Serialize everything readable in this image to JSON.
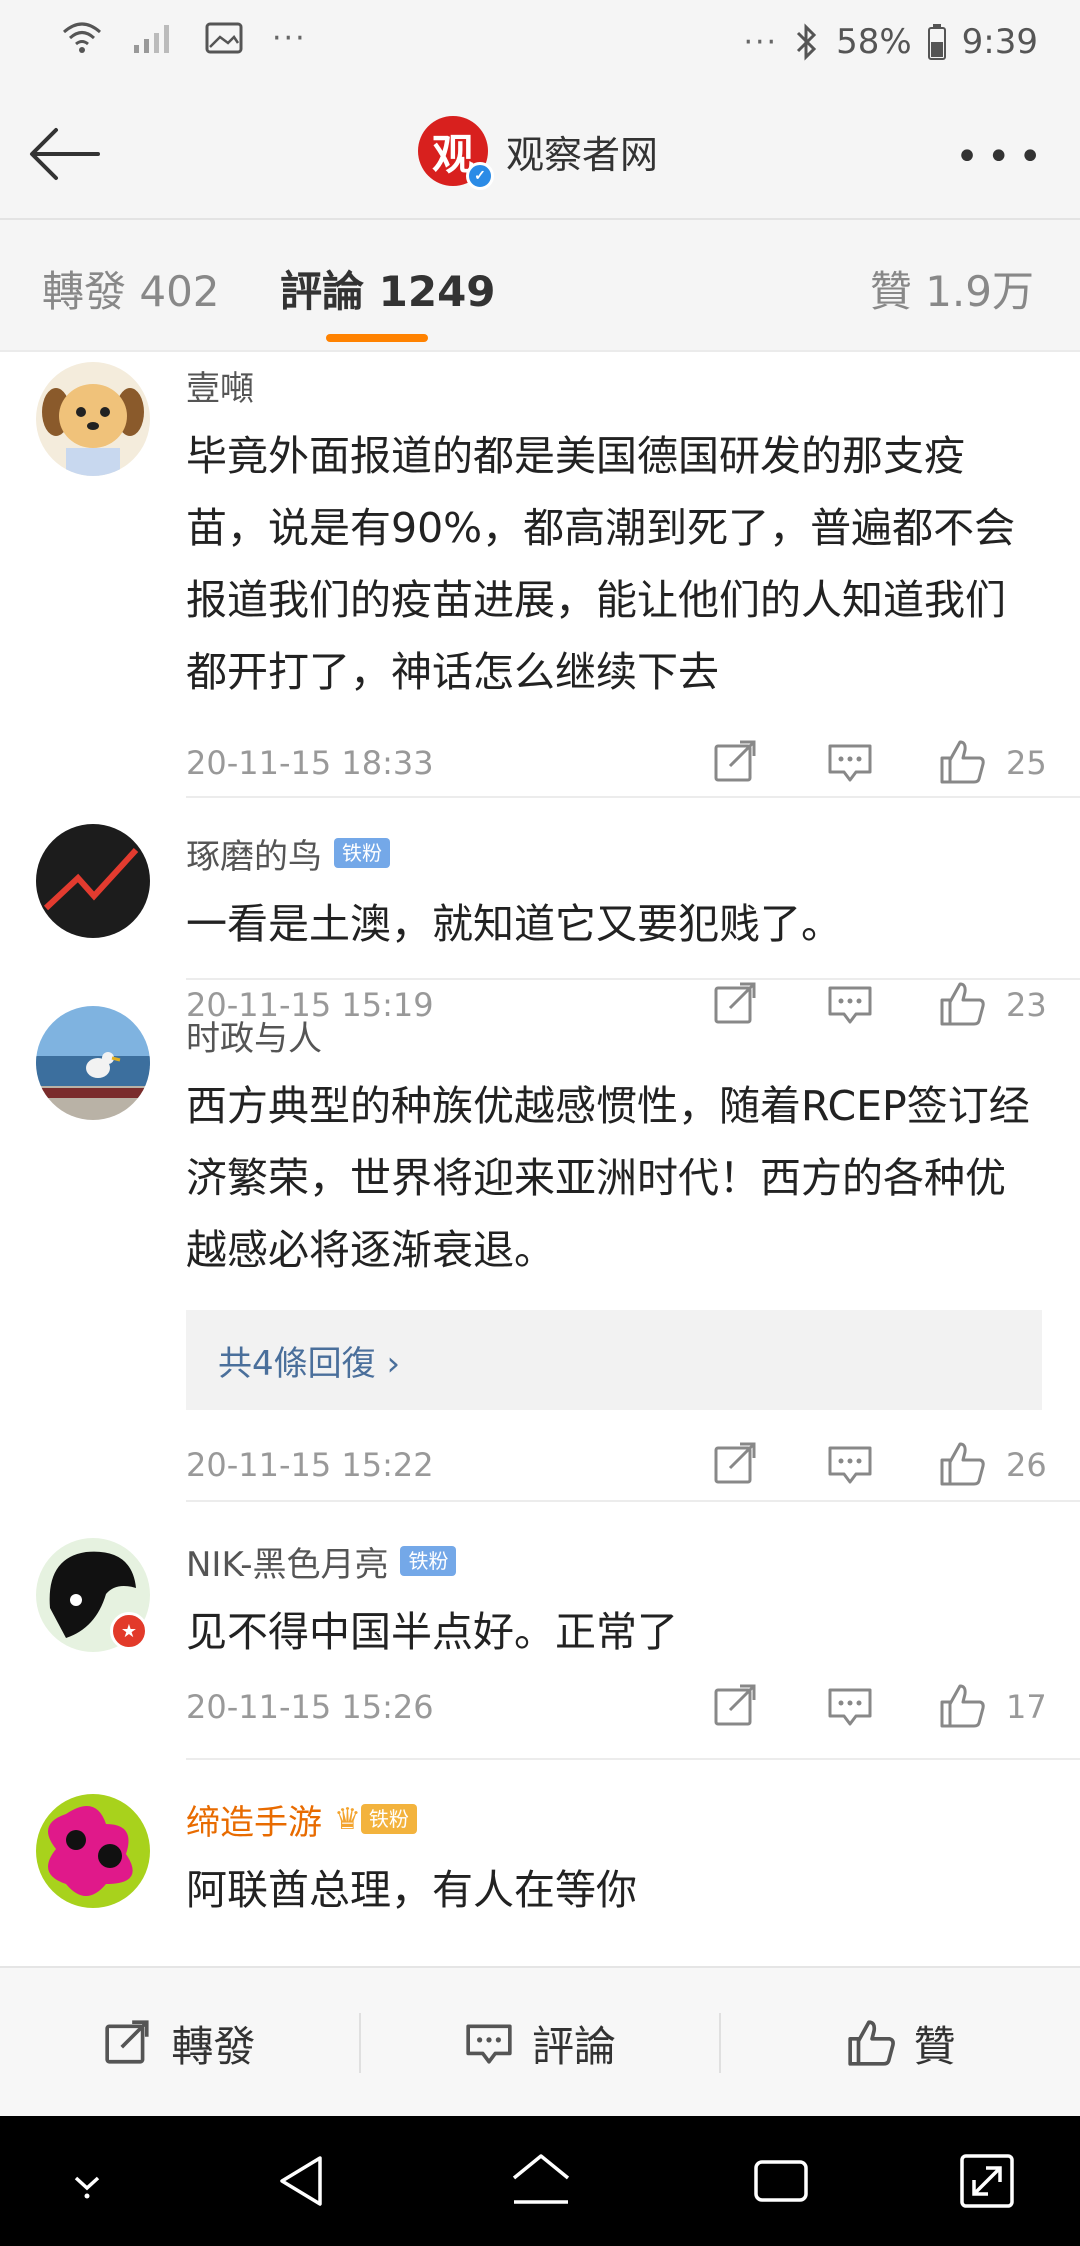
{
  "status_bar": {
    "battery": "58%",
    "time": "9:39",
    "left_more": "···",
    "right_more": "···"
  },
  "header": {
    "logo_char": "观",
    "title": "观察者网"
  },
  "tabs": {
    "forward": "轉發 402",
    "comment": "評論 1249",
    "like": "贊 1.9万"
  },
  "comments": [
    {
      "username": "壹噸",
      "text": "毕竟外面报道的都是美国德国研发的那支疫苗，说是有90%，都高潮到死了，普遍都不会报道我们的疫苗进展，能让他们的人知道我们都开打了，神话怎么继续下去",
      "time": "20-11-15 18:33",
      "likes": "25"
    },
    {
      "username": "琢磨的鸟",
      "badge": "铁粉",
      "text": "一看是土澳，就知道它又要犯贱了。",
      "time": "20-11-15 15:19",
      "likes": "23"
    },
    {
      "username": "时政与人",
      "text": "西方典型的种族优越感惯性，随着RCEP签订经济繁荣，世界将迎来亚洲时代！西方的各种优越感必将逐渐衰退。",
      "replies": "共4條回復 ›",
      "time": "20-11-15 15:22",
      "likes": "26"
    },
    {
      "username": "NIK-黑色月亮",
      "badge": "铁粉",
      "text": "见不得中国半点好。正常了",
      "time": "20-11-15 15:26",
      "likes": "17"
    },
    {
      "username": "缔造手游",
      "badge": "铁粉",
      "text": "阿联酋总理，有人在等你"
    }
  ],
  "bottom_bar": {
    "forward": "轉發",
    "comment": "評論",
    "like": "贊"
  },
  "colors": {
    "accent": "#ff8200",
    "link": "#4a6f9b",
    "fan_badge": "#74a8e8",
    "logo": "#d8201e"
  }
}
